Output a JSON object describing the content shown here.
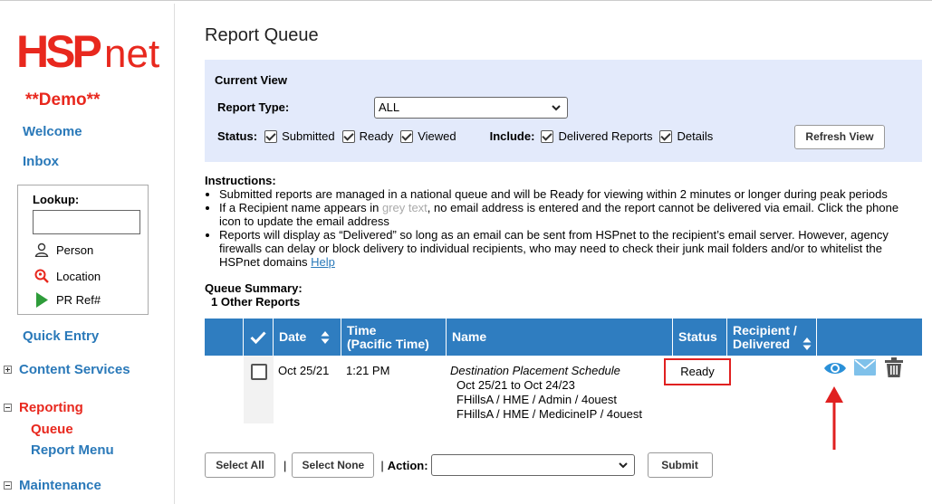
{
  "app": {
    "logo_text": "HSPnet",
    "demo_label": "**Demo**"
  },
  "sidebar": {
    "welcome": "Welcome",
    "inbox": "Inbox",
    "lookup": {
      "label": "Lookup:",
      "input_value": "",
      "items": [
        {
          "label": "Person",
          "icon": "person-icon"
        },
        {
          "label": "Location",
          "icon": "location-search-icon"
        },
        {
          "label": "PR Ref#",
          "icon": "play-icon"
        }
      ]
    },
    "quick_entry": "Quick Entry",
    "content_services": "Content Services",
    "reporting": "Reporting",
    "queue": "Queue",
    "report_menu": "Report Menu",
    "maintenance": "Maintenance"
  },
  "main": {
    "title": "Report Queue",
    "current_view": {
      "title": "Current View",
      "report_type_label": "Report Type:",
      "report_type_value": "ALL",
      "status_label": "Status:",
      "status_options": [
        {
          "label": "Submitted",
          "checked": true
        },
        {
          "label": "Ready",
          "checked": true
        },
        {
          "label": "Viewed",
          "checked": true
        }
      ],
      "include_label": "Include:",
      "include_options": [
        {
          "label": "Delivered Reports",
          "checked": true
        },
        {
          "label": "Details",
          "checked": true
        }
      ],
      "refresh_button": "Refresh View"
    },
    "instructions": {
      "heading": "Instructions:",
      "item1": "Submitted reports are managed in a national queue and will be Ready for viewing within 2 minutes or longer during peak periods",
      "item2_a": "If a Recipient name appears in ",
      "item2_grey": "grey text",
      "item2_b": ", no email address is entered and the report cannot be delivered via email. Click the phone icon to update the email address",
      "item3": "Reports will display as “Delivered” so long as an email can be sent from HSPnet to the recipient’s email server. However, agency firewalls can delay or block delivery to individual recipients, who may need to check their junk mail folders and/or to whitelist the HSPnet domains ",
      "help_link": "Help"
    },
    "queue_summary": {
      "heading": "Queue Summary:",
      "count": "1 Other Reports"
    },
    "table": {
      "headers": {
        "date": "Date",
        "time": "Time",
        "time_sub": "(Pacific Time)",
        "name": "Name",
        "status": "Status",
        "recipient": "Recipient /",
        "recipient_sub": "Delivered"
      },
      "rows": [
        {
          "checked": false,
          "date": "Oct 25/21",
          "time": "1:21 PM",
          "name": "Destination Placement Schedule",
          "line2": "Oct 25/21 to Oct 24/23",
          "line3": "FHillsA / HME / Admin / 4ouest",
          "line4": "FHillsA / HME / MedicineIP / 4ouest",
          "status": "Ready",
          "actions": [
            "eye-icon",
            "envelope-icon",
            "trash-icon"
          ]
        }
      ]
    },
    "bottom": {
      "select_all": "Select All",
      "select_none": "Select None",
      "action_label": "Action:",
      "action_value": "",
      "submit": "Submit",
      "sep": "|"
    }
  },
  "colors": {
    "brand_red": "#e8281e",
    "link_blue": "#2a79b9",
    "table_header": "#2f7dc0",
    "panel_bg": "#e3eafb",
    "highlight_red": "#e02020"
  }
}
